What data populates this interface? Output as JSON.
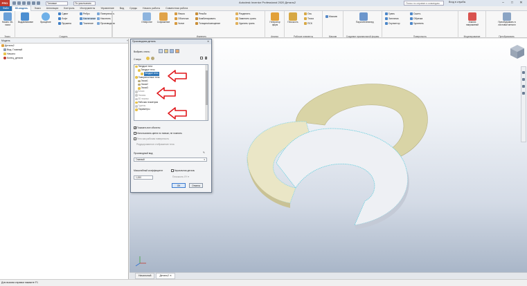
{
  "titlebar": {
    "app_button": "PRO",
    "combo_value": "Типовые",
    "combo2_value": "По умолчанию",
    "window_title": "Autodesk Inventor Professional 2020   Деталь2",
    "search_placeholder": "Поиск по справке и командам",
    "user": "Вход в службы",
    "minimize": "–",
    "maximize": "□",
    "close": "✕"
  },
  "tabs": [
    "Файл",
    "3D-модель",
    "Эскиз",
    "Аннотации",
    "Контроль",
    "Инструменты",
    "Управление",
    "Вид",
    "Среды",
    "Начало работы",
    "Совместная работа"
  ],
  "ribbon": {
    "groups": {
      "sketch": "Эскиз",
      "create": "Создать",
      "modify": "Изменить",
      "explore": "Анализ",
      "work_features": "Рабочие элементы",
      "pattern": "Массив",
      "freeform": "Создание произвольной формы",
      "surface": "Поверхность",
      "simulation": "Моделирование",
      "convert": "Преобразовать"
    },
    "sketch_btn": "Начать 3D-эскиз",
    "extrude": "Выдавливание",
    "revolve": "Вращение",
    "create_small": [
      "Сдвиг",
      "Лофт",
      "Пружина",
      "Ребро",
      "Нагнетание",
      "Тиснение",
      "Поверхность",
      "Наклеить",
      "Производная"
    ],
    "modify_big": [
      "Отверстие",
      "Сопряжение"
    ],
    "modify_small": [
      "Фаска",
      "Оболочка",
      "Уклон",
      "Резьба",
      "Разделить",
      "Комбинировать",
      "Толщина/смещение",
      "Заменить грань",
      "Удалить грань"
    ],
    "explore_btn": "Генератор форм",
    "work_small": [
      "Плоскость",
      "Ось",
      "Точка",
      "ПСК"
    ],
    "pattern_small": [
      "Массив"
    ],
    "freeform_btn": "Параллелепипед",
    "surface_small": [
      "Грань",
      "Заплатка",
      "Скульптор",
      "Сшить",
      "Обрезка",
      "Удлинить"
    ],
    "simulation_btn": "Анализ напряжений",
    "convert_btn": "Преобразовать в листовой металл"
  },
  "browser": {
    "title": "Модель",
    "nodes": [
      "Деталь2",
      "Вид: Главный",
      "Начало",
      "Конец_детали"
    ]
  },
  "dialog": {
    "title": "Производная деталь",
    "row_selection": "Выбрать стиль:",
    "row_status": "Статус:",
    "tree_items": [
      "Твердые тела",
      "Твердое тело",
      "Поверхностные тела",
      "Эскиз1",
      "Эскиз2",
      "Эскиз3",
      "Блоки",
      "Эскизы",
      "3D эскизы",
      "Рабочая геометрия",
      "Группы",
      "Параметры"
    ],
    "show_all_objects": "Показать все объекты",
    "option_color": "Использовать цвета по новым, не помнить",
    "option_body_as_work": "Тело как рабочая поверхность",
    "option_reduced": "Редуцированное отображение тела",
    "rep_label": "Производный вид:",
    "rep_value": "Главный",
    "scale_label": "Масштабный коэффициент",
    "scale_value": "1,000",
    "mirror_label": "Зеркальная деталь",
    "mirror_plane": "Плоскость XY",
    "ok": "ОК",
    "cancel": "Отмена"
  },
  "doctabs": [
    "Начальный",
    "Деталь2"
  ],
  "status": "Для вызова справки нажмите F1"
}
